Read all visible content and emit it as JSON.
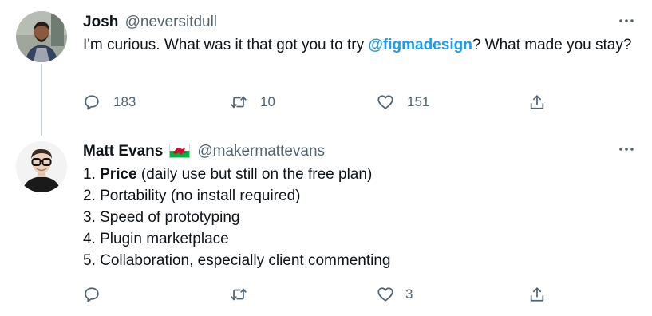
{
  "tweets": [
    {
      "name": "Josh",
      "handle": "@neversitdull",
      "text_before": "I'm curious. What was it that got you to try ",
      "mention": "@figmadesign",
      "text_after": "? What made you stay?",
      "actions": {
        "replies": "183",
        "retweets": "10",
        "likes": "151"
      }
    },
    {
      "name": "Matt Evans",
      "handle": "@makermattevans",
      "flag_icon": "wales-flag-icon",
      "list": [
        {
          "prefix": "1. ",
          "bold": "Price",
          "rest": " (daily use but still on the free plan)"
        },
        {
          "text": "2. Portability (no install required)"
        },
        {
          "text": "3. Speed of prototyping"
        },
        {
          "text": "4. Plugin marketplace"
        },
        {
          "text": "5. Collaboration, especially client commenting"
        }
      ],
      "actions": {
        "replies": "",
        "retweets": "",
        "likes": "3"
      }
    }
  ],
  "colors": {
    "accent": "#1d9bf0",
    "muted": "#536471",
    "text": "#0f1419",
    "thread_line": "#c4cfd6"
  }
}
